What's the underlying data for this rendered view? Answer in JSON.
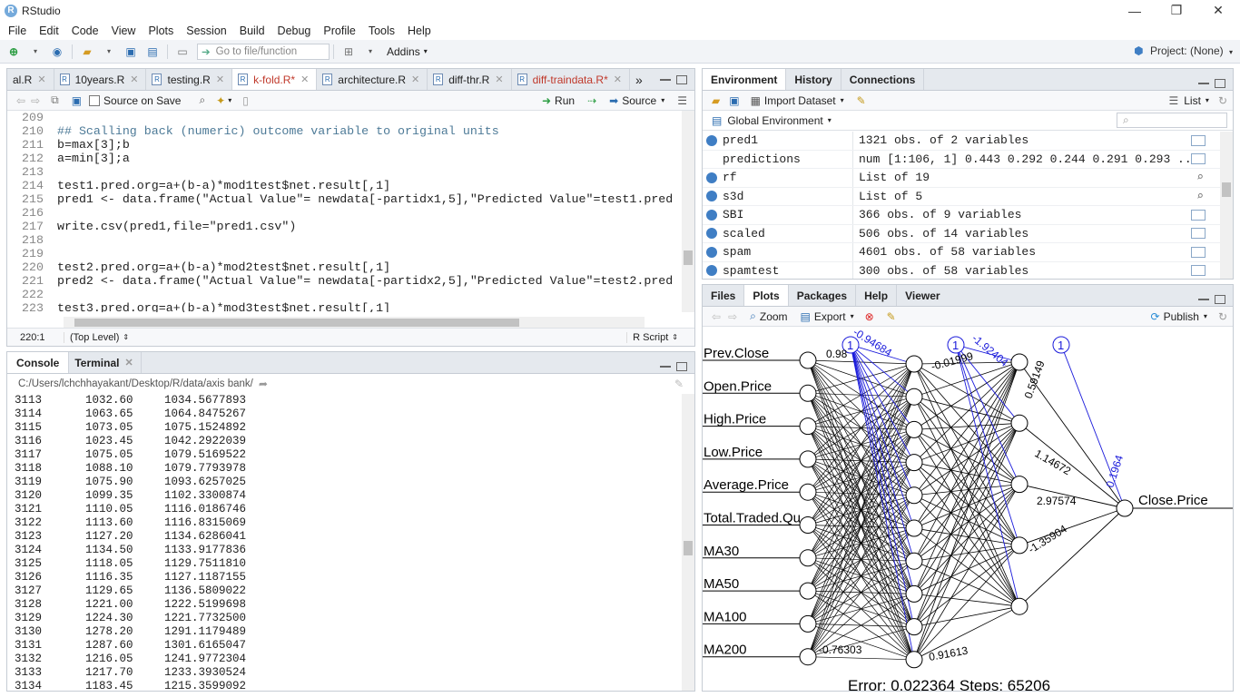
{
  "window": {
    "title": "RStudio",
    "logo": "R",
    "minimize": "—",
    "restore": "❐",
    "close": "✕"
  },
  "menu": [
    "File",
    "Edit",
    "Code",
    "View",
    "Plots",
    "Session",
    "Build",
    "Debug",
    "Profile",
    "Tools",
    "Help"
  ],
  "toolbar": {
    "goto_placeholder": "Go to file/function",
    "addins": "Addins",
    "project": "Project: (None)"
  },
  "editor": {
    "tabs": [
      {
        "label": "al.R"
      },
      {
        "label": "10years.R"
      },
      {
        "label": "testing.R"
      },
      {
        "label": "k-fold.R*",
        "active": true
      },
      {
        "label": "architecture.R"
      },
      {
        "label": "diff-thr.R"
      },
      {
        "label": "diff-traindata.R*"
      }
    ],
    "overflow": "»",
    "source_on_save": "Source on Save",
    "run": "Run",
    "source": "Source",
    "lines": [
      {
        "n": "209",
        "text": "",
        "kind": "plain"
      },
      {
        "n": "210",
        "text": "## Scalling back (numeric) outcome variable to original units",
        "kind": "comment"
      },
      {
        "n": "211",
        "text": "b=max[3];b",
        "kind": "plain"
      },
      {
        "n": "212",
        "text": "a=min[3];a",
        "kind": "plain"
      },
      {
        "n": "213",
        "text": "",
        "kind": "plain"
      },
      {
        "n": "214",
        "text": "test1.pred.org=a+(b-a)*mod1test$net.result[,1]",
        "kind": "plain"
      },
      {
        "n": "215",
        "text": "pred1 <- data.frame(\"Actual Value\"= newdata[-partidx1,5],\"Predicted Value\"=test1.pred",
        "kind": "plain"
      },
      {
        "n": "216",
        "text": "",
        "kind": "plain"
      },
      {
        "n": "217",
        "text": "write.csv(pred1,file=\"pred1.csv\")",
        "kind": "plain"
      },
      {
        "n": "218",
        "text": "",
        "kind": "plain"
      },
      {
        "n": "219",
        "text": "",
        "kind": "plain"
      },
      {
        "n": "220",
        "text": "test2.pred.org=a+(b-a)*mod2test$net.result[,1]",
        "kind": "plain"
      },
      {
        "n": "221",
        "text": "pred2 <- data.frame(\"Actual Value\"= newdata[-partidx2,5],\"Predicted Value\"=test2.pred",
        "kind": "plain"
      },
      {
        "n": "222",
        "text": "",
        "kind": "plain"
      },
      {
        "n": "223",
        "text": "test3.pred.org=a+(b-a)*mod3test$net.result[,1]",
        "kind": "plain"
      },
      {
        "n": "224",
        "text": "",
        "kind": "plain"
      }
    ],
    "status_pos": "220:1",
    "status_scope": "(Top Level)",
    "status_type": "R Script"
  },
  "console": {
    "tabs": [
      "Console",
      "Terminal"
    ],
    "path": "C:/Users/lchchhayakant/Desktop/R/data/axis bank/",
    "rows": [
      [
        "3113",
        "1032.60",
        "1034.5677893"
      ],
      [
        "3114",
        "1063.65",
        "1064.8475267"
      ],
      [
        "3115",
        "1073.05",
        "1075.1524892"
      ],
      [
        "3116",
        "1023.45",
        "1042.2922039"
      ],
      [
        "3117",
        "1075.05",
        "1079.5169522"
      ],
      [
        "3118",
        "1088.10",
        "1079.7793978"
      ],
      [
        "3119",
        "1075.90",
        "1093.6257025"
      ],
      [
        "3120",
        "1099.35",
        "1102.3300874"
      ],
      [
        "3121",
        "1110.05",
        "1116.0186746"
      ],
      [
        "3122",
        "1113.60",
        "1116.8315069"
      ],
      [
        "3123",
        "1127.20",
        "1134.6286041"
      ],
      [
        "3124",
        "1134.50",
        "1133.9177836"
      ],
      [
        "3125",
        "1118.05",
        "1129.7511810"
      ],
      [
        "3126",
        "1116.35",
        "1127.1187155"
      ],
      [
        "3127",
        "1129.65",
        "1136.5809022"
      ],
      [
        "3128",
        "1221.00",
        "1222.5199698"
      ],
      [
        "3129",
        "1224.30",
        "1221.7732500"
      ],
      [
        "3130",
        "1278.20",
        "1291.1179489"
      ],
      [
        "3131",
        "1287.60",
        "1301.6165047"
      ],
      [
        "3132",
        "1216.05",
        "1241.9772304"
      ],
      [
        "3133",
        "1217.70",
        "1233.3930524"
      ],
      [
        "3134",
        "1183.45",
        "1215.3599092"
      ]
    ]
  },
  "environment": {
    "tabs": [
      "Environment",
      "History",
      "Connections"
    ],
    "import_dataset": "Import Dataset",
    "list_view": "List",
    "scope": "Global Environment",
    "rows": [
      {
        "name": "pred1",
        "value": "1321 obs. of 2 variables",
        "bullet": true,
        "icon": "table"
      },
      {
        "name": "predictions",
        "value": "num [1:106, 1] 0.443 0.292 0.244 0.291 0.293 ...",
        "bullet": false,
        "icon": "table"
      },
      {
        "name": "rf",
        "value": "List of 19",
        "bullet": true,
        "icon": "search"
      },
      {
        "name": "s3d",
        "value": "List of 5",
        "bullet": true,
        "icon": "search"
      },
      {
        "name": "SBI",
        "value": "366 obs. of 9 variables",
        "bullet": true,
        "icon": "table"
      },
      {
        "name": "scaled",
        "value": "506 obs. of 14 variables",
        "bullet": true,
        "icon": "table"
      },
      {
        "name": "spam",
        "value": "4601 obs. of 58 variables",
        "bullet": true,
        "icon": "table"
      },
      {
        "name": "spamtest",
        "value": "300 obs. of 58 variables",
        "bullet": true,
        "icon": "table"
      }
    ]
  },
  "plots": {
    "tabs": [
      "Files",
      "Plots",
      "Packages",
      "Help",
      "Viewer"
    ],
    "zoom": "Zoom",
    "export": "Export",
    "publish": "Publish",
    "inputs": [
      "Prev.Close",
      "Open.Price",
      "High.Price",
      "Low.Price",
      "Average.Price",
      "Total.Traded.Qu",
      "MA30",
      "MA50",
      "MA100",
      "MA200"
    ],
    "output": "Close.Price",
    "bias_label": "1",
    "weights": {
      "w1": "0.98",
      "w2": "-0.94684",
      "w3": "-0.01999",
      "w4": "-1.92404",
      "w5": "0.59149",
      "w6": "1.14672",
      "w7": "2.97574",
      "w8": "-1.35904",
      "w9": "0.1964",
      "w10": "-0.76303",
      "w11": "0.91613"
    },
    "footer": "Error: 0.022364   Steps: 65206",
    "colors": {
      "bias": "#1a1adb",
      "edge": "#000000"
    }
  }
}
